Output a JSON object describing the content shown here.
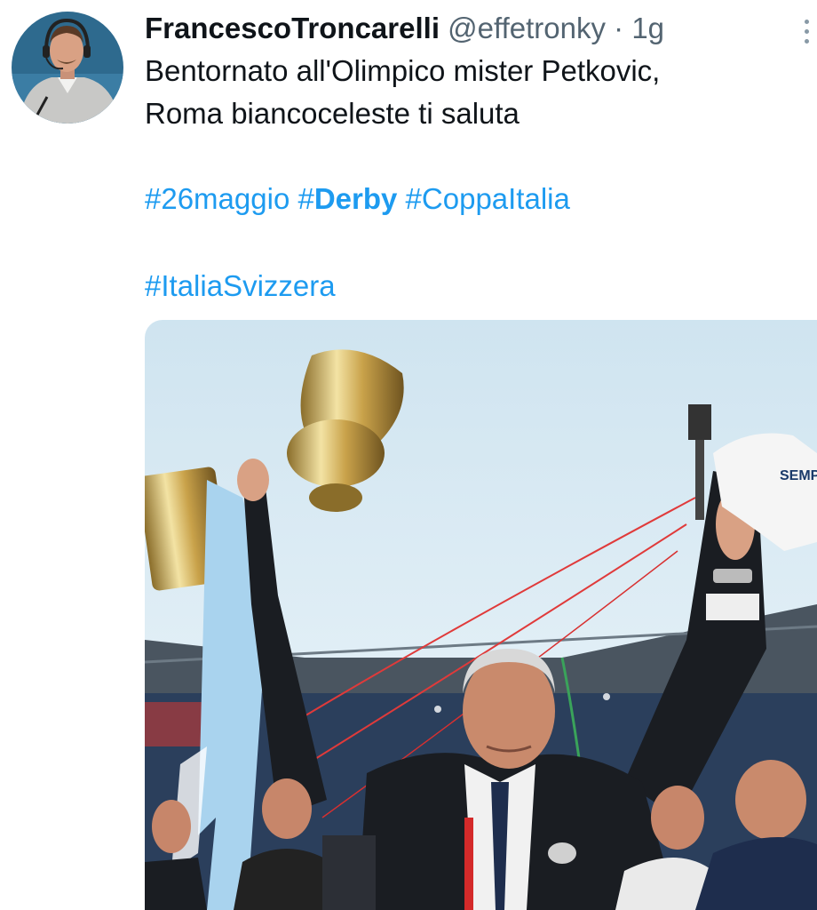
{
  "tweet": {
    "author": {
      "display_name": "FrancescoTroncarelli",
      "handle": "@effetronky",
      "separator": "·",
      "time": "1g"
    },
    "text_lines": [
      "Bentornato all'Olimpico mister Petkovic,",
      "Roma biancoceleste ti saluta"
    ],
    "hashtags_row1": [
      "#26maggio",
      "#Derby",
      "#CoppaItalia"
    ],
    "hashtags_row1_emphasis": "#Derby",
    "hashtags_row2": [
      "#ItaliaSvizzera"
    ],
    "media": {
      "shirt_text": "SEMP DEL"
    }
  },
  "icons": {
    "more": "more-options-icon"
  },
  "colors": {
    "text": "#0f1419",
    "secondary": "#536471",
    "link": "#1d9bf0",
    "sky": "#dfeef6",
    "suit": "#1a1d22"
  }
}
